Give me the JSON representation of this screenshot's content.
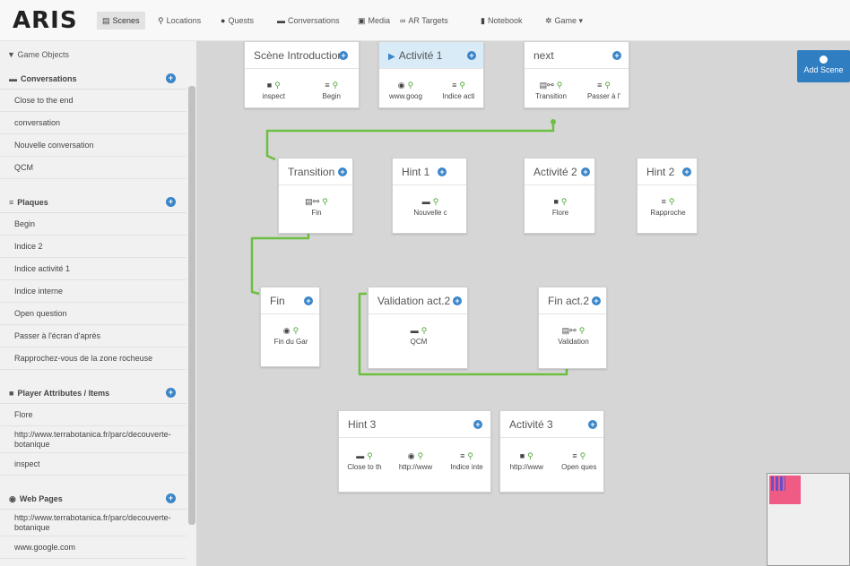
{
  "nav": {
    "logo": "ARIS",
    "items": [
      {
        "icon": "film-icon",
        "glyph": "▤",
        "label": "Scenes",
        "active": true
      },
      {
        "icon": "map-marker-icon",
        "glyph": "⚲",
        "label": "Locations"
      },
      {
        "icon": "info-icon",
        "glyph": "●",
        "label": "Quests"
      },
      {
        "icon": "comment-icon",
        "glyph": "▬",
        "label": "Conversations"
      },
      {
        "icon": "picture-icon",
        "glyph": "▣",
        "label": "Media"
      },
      {
        "icon": "link-icon",
        "glyph": "∞",
        "label": "AR Targets"
      },
      {
        "icon": "book-icon",
        "glyph": "▮",
        "label": "Notebook"
      },
      {
        "icon": "gear-icon",
        "glyph": "✲",
        "label": "Game ▾"
      }
    ]
  },
  "sidebar": {
    "title": "Game Objects",
    "sections": [
      {
        "id": "conversations",
        "title": "Conversations",
        "glyph": "▬",
        "items": [
          "Close to the end",
          "conversation",
          "Nouvelle conversation",
          "QCM"
        ]
      },
      {
        "id": "plaques",
        "title": "Plaques",
        "glyph": "≡",
        "items": [
          "Begin",
          "Indice 2",
          "Indice activité 1",
          "Indice interne",
          "Open question",
          "Passer à l'écran d'après",
          "Rapprochez-vous de la zone rocheuse"
        ]
      },
      {
        "id": "items",
        "title": "Player Attributes / Items",
        "glyph": "■",
        "items": [
          "Flore",
          "http://www.terrabotanica.fr/parc/decouverte-botanique",
          "inspect"
        ]
      },
      {
        "id": "webpages",
        "title": "Web Pages",
        "glyph": "◉",
        "items": [
          "http://www.terrabotanica.fr/parc/decouverte-botanique",
          "www.google.com"
        ]
      }
    ]
  },
  "canvas": {
    "add_scene_label": "Add Scene",
    "scenes": [
      {
        "id": "intro",
        "title": "Scène Introduction",
        "triggers": [
          {
            "glyph": "■",
            "label": "inspect"
          },
          {
            "glyph": "≡",
            "label": "Begin"
          }
        ]
      },
      {
        "id": "act1",
        "title": "Activité 1",
        "start": true,
        "triggers": [
          {
            "glyph": "◉",
            "label": "www.goog"
          },
          {
            "glyph": "≡",
            "label": "Indice acti"
          }
        ]
      },
      {
        "id": "next",
        "title": "next",
        "triggers": [
          {
            "glyph": "▤⚯",
            "label": "Transition"
          },
          {
            "glyph": "≡",
            "label": "Passer à l'"
          }
        ]
      },
      {
        "id": "transition",
        "title": "Transition",
        "triggers": [
          {
            "glyph": "▤⚯",
            "label": "Fin"
          }
        ]
      },
      {
        "id": "hint1",
        "title": "Hint 1",
        "triggers": [
          {
            "glyph": "▬",
            "label": "Nouvelle c"
          }
        ]
      },
      {
        "id": "act2",
        "title": "Activité 2",
        "triggers": [
          {
            "glyph": "■",
            "label": "Flore"
          }
        ]
      },
      {
        "id": "hint2",
        "title": "Hint 2",
        "triggers": [
          {
            "glyph": "≡",
            "label": "Rapproche"
          }
        ]
      },
      {
        "id": "fin",
        "title": "Fin",
        "triggers": [
          {
            "glyph": "◉",
            "label": "Fin du Gar"
          }
        ]
      },
      {
        "id": "valid2",
        "title": "Validation act.2",
        "triggers": [
          {
            "glyph": "▬",
            "label": "QCM"
          }
        ]
      },
      {
        "id": "finact2",
        "title": "Fin act.2",
        "triggers": [
          {
            "glyph": "▤⚯",
            "label": "Validation"
          }
        ]
      },
      {
        "id": "hint3",
        "title": "Hint 3",
        "triggers": [
          {
            "glyph": "▬",
            "label": "Close to th"
          },
          {
            "glyph": "◉",
            "label": "http://www"
          },
          {
            "glyph": "≡",
            "label": "Indice inte"
          }
        ]
      },
      {
        "id": "act3",
        "title": "Activité 3",
        "triggers": [
          {
            "glyph": "■",
            "label": "http://www"
          },
          {
            "glyph": "≡",
            "label": "Open ques"
          }
        ]
      }
    ]
  },
  "colors": {
    "accent": "#3a86c9",
    "link": "#6cbf3f",
    "start_highlight": "#d9ebf6",
    "minimap": "#f05b86"
  }
}
